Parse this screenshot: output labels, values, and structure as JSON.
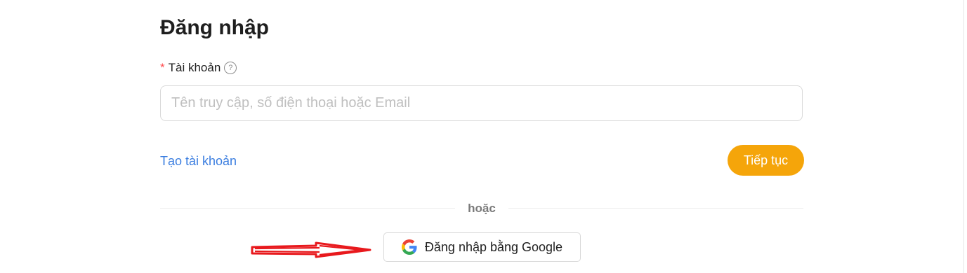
{
  "form": {
    "title": "Đăng nhập",
    "account_label": "Tài khoản",
    "required_mark": "*",
    "help_icon": "question-circle-icon",
    "account_input": {
      "value": "",
      "placeholder": "Tên truy cập, số điện thoại hoặc Email"
    },
    "create_account_link": "Tạo tài khoản",
    "continue_button": "Tiếp tục",
    "divider_text": "hoặc",
    "google_button": "Đăng nhập bằng Google",
    "google_icon": "google-logo-icon"
  },
  "annotation": {
    "arrow_icon": "red-arrow-icon",
    "arrow_color": "#e8191d"
  },
  "colors": {
    "accent": "#f5a50a",
    "link": "#3b7ee0",
    "required": "#ff4d4f"
  }
}
